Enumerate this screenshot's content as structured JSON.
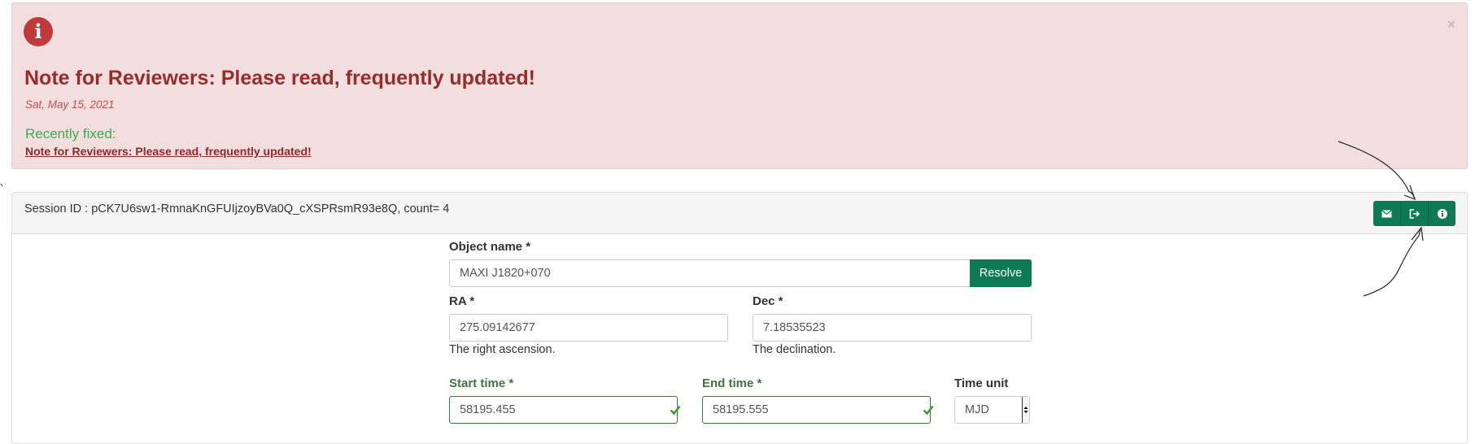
{
  "alert": {
    "icon": "info-icon",
    "close_symbol": "×",
    "title": "Note for Reviewers: Please read, frequently updated!",
    "date": "Sat, May 15, 2021",
    "fixed_label": "Recently fixed:",
    "link_text": "Note for Reviewers: Please read, frequently updated!",
    "colors": {
      "background": "#f2dede",
      "title": "#9a2b2b",
      "fixed": "#3daa55"
    }
  },
  "panel": {
    "session_text": "Session ID : pCK7U6sw1-RmnaKnGFUIjzoyBVa0Q_cXSPRsmR93e8Q, count= 4",
    "toolbar": {
      "buttons": [
        "envelope-icon",
        "sign-out-icon",
        "info-icon"
      ],
      "color": "#0e7a55"
    }
  },
  "form": {
    "object_name": {
      "label": "Object name *",
      "value": "MAXI J1820+070",
      "button": "Resolve"
    },
    "ra": {
      "label": "RA *",
      "value": "275.09142677",
      "help": "The right ascension."
    },
    "dec": {
      "label": "Dec *",
      "value": "7.18535523",
      "help": "The declination."
    },
    "start_time": {
      "label": "Start time *",
      "value": "58195.455"
    },
    "end_time": {
      "label": "End time *",
      "value": "58195.555"
    },
    "time_unit": {
      "label": "Time unit",
      "value": "MJD"
    }
  }
}
